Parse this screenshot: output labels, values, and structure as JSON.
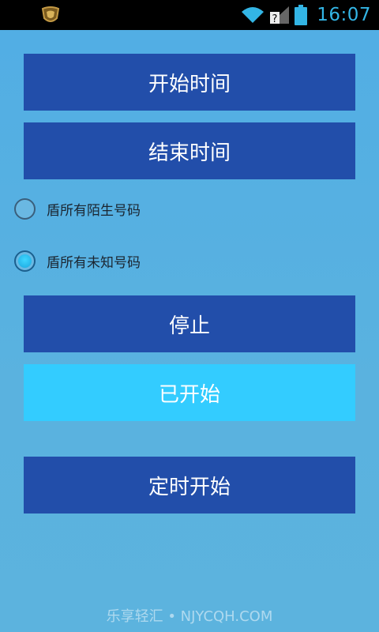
{
  "status_bar": {
    "time": "16:07",
    "icons": [
      "app-shield-icon",
      "wifi-icon",
      "signal-icon",
      "battery-icon"
    ],
    "accent": "#33b5e5"
  },
  "buttons": {
    "start_time": "开始时间",
    "end_time": "结束时间",
    "stop": "停止",
    "started": "已开始",
    "scheduled_start": "定时开始"
  },
  "radio_options": [
    {
      "label": "盾所有陌生号码",
      "checked": false
    },
    {
      "label": "盾所有未知号码",
      "checked": true
    }
  ],
  "watermark": "乐享轻汇 • NJYCQH.COM",
  "colors": {
    "background": "#5ab0de",
    "button": "#224eaa",
    "button_active": "#33ccff"
  }
}
